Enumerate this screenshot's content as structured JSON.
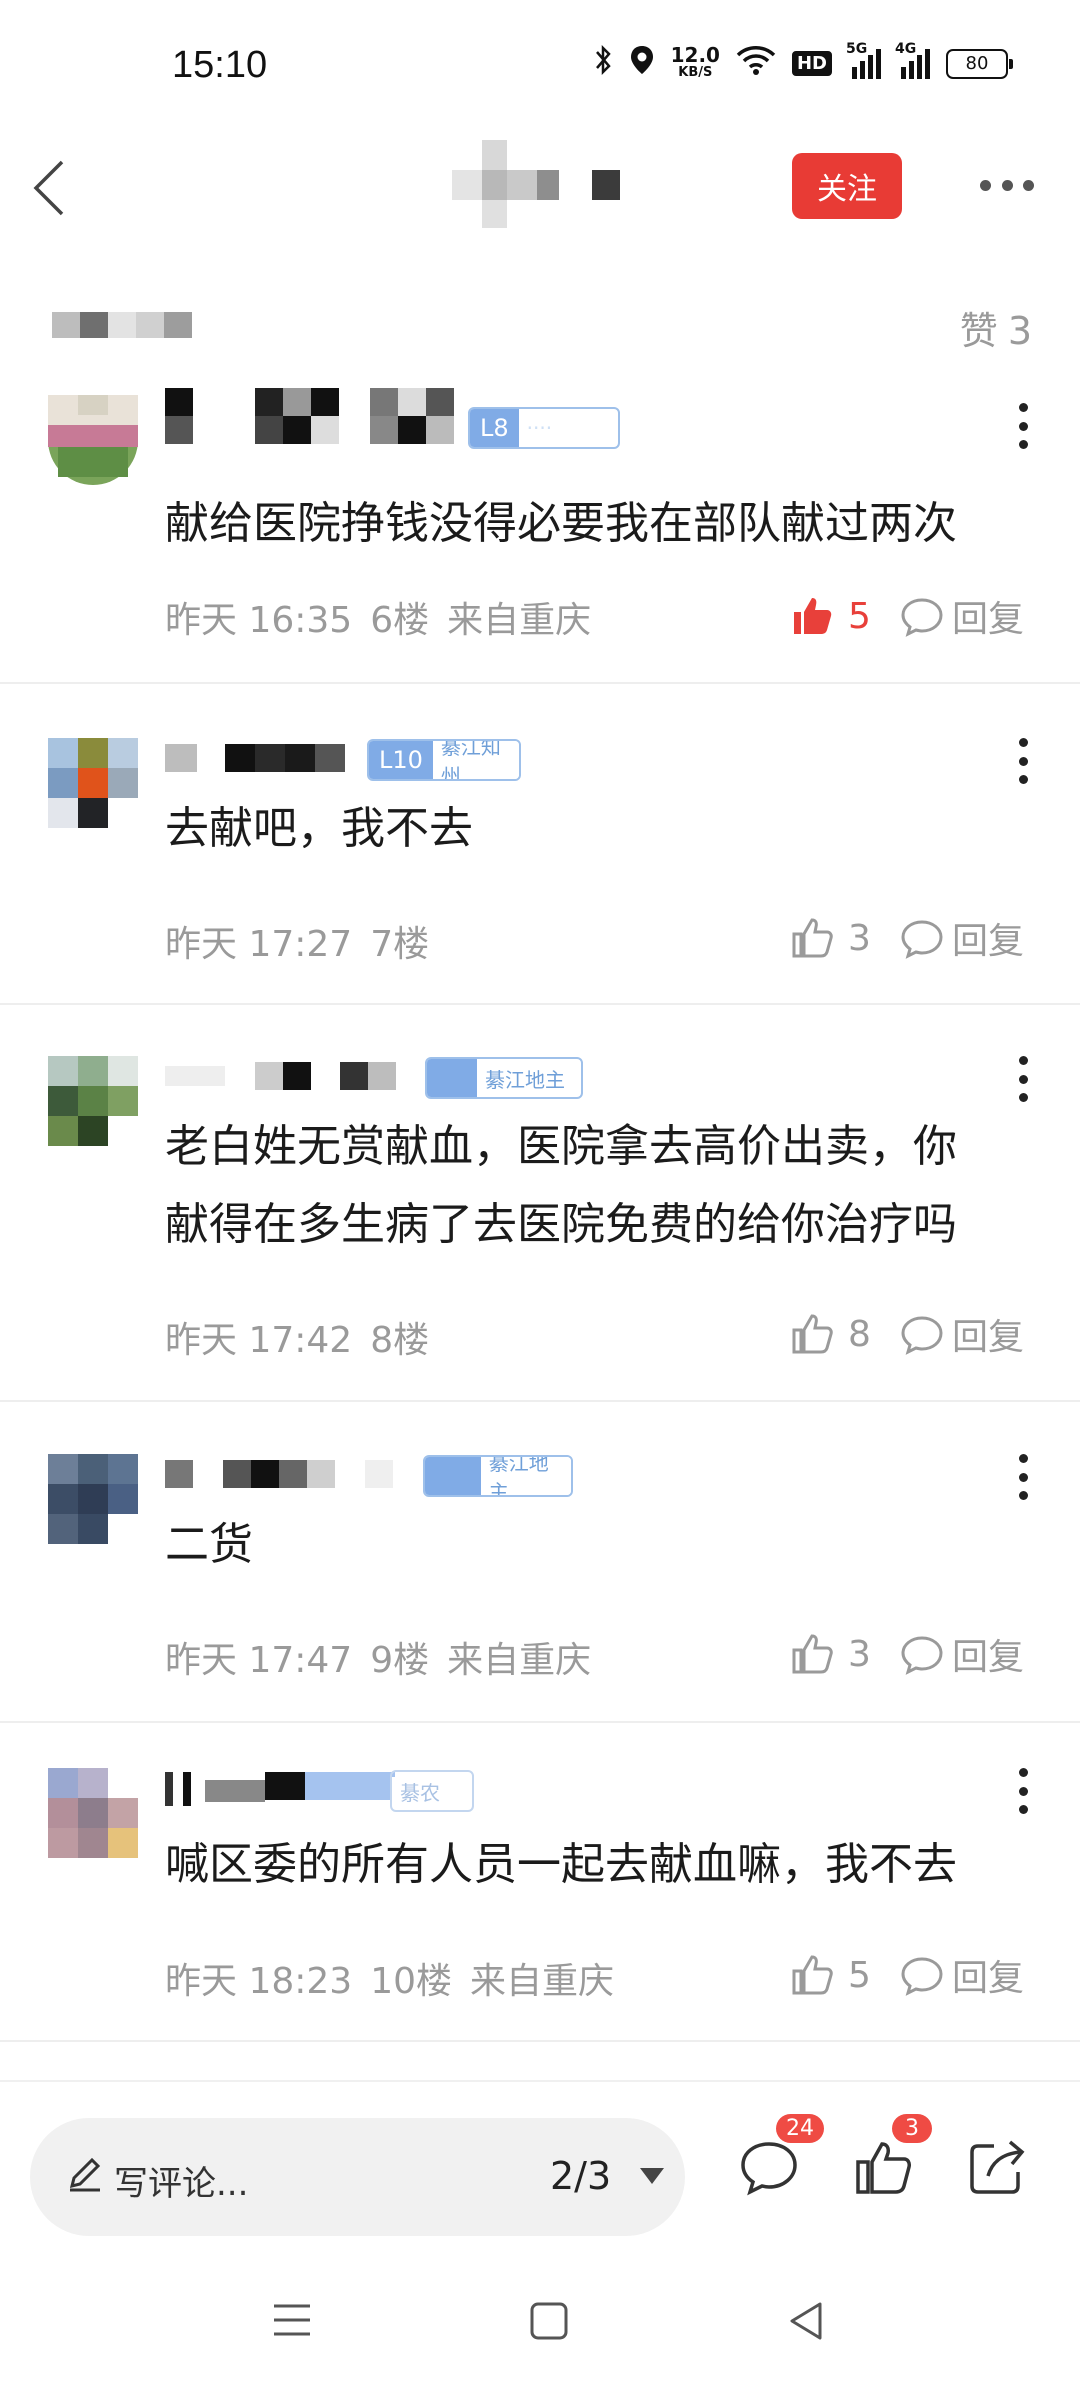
{
  "status_bar": {
    "time": "15:10",
    "net_speed_value": "12.0",
    "net_speed_unit": "KB/S",
    "hd_label": "HD",
    "signal1_label": "5G",
    "signal2_label": "4G",
    "battery": "80"
  },
  "header": {
    "follow_label": "关注",
    "likes_label": "赞",
    "likes_count": "3"
  },
  "comments": [
    {
      "level": "L8",
      "text_lines": [
        "献给医院挣钱没得必要我在部队献过两次"
      ],
      "time": "昨天 16:35",
      "floor": "6楼",
      "location": "来自重庆",
      "likes": "5",
      "liked": true,
      "reply_label": "回复"
    },
    {
      "level": "L10",
      "badge": "綦江知州",
      "text_lines": [
        "去献吧，我不去"
      ],
      "time": "昨天 17:27",
      "floor": "7楼",
      "location": "",
      "likes": "3",
      "liked": false,
      "reply_label": "回复"
    },
    {
      "level": "",
      "badge": "綦江地主",
      "text_lines": [
        "老白姓无赏献血，医院拿去高价出卖，你",
        "献得在多生病了去医院免费的给你治疗吗"
      ],
      "time": "昨天 17:42",
      "floor": "8楼",
      "location": "",
      "likes": "8",
      "liked": false,
      "reply_label": "回复"
    },
    {
      "level": "",
      "badge": "綦江地主",
      "text_lines": [
        "二货"
      ],
      "time": "昨天 17:47",
      "floor": "9楼",
      "location": "来自重庆",
      "likes": "3",
      "liked": false,
      "reply_label": "回复"
    },
    {
      "level": "",
      "badge": "綦农",
      "text_lines": [
        "喊区委的所有人员一起去献血嘛，我不去"
      ],
      "time": "昨天 18:23",
      "floor": "10楼",
      "location": "来自重庆",
      "likes": "5",
      "liked": false,
      "reply_label": "回复"
    }
  ],
  "bottom_bar": {
    "write_placeholder": "写评论...",
    "page_indicator": "2/3",
    "comment_badge": "24",
    "like_badge": "3"
  },
  "colors": {
    "accent_red": "#e83b35",
    "meta_gray": "#9a9a9a",
    "level_blue": "#80abe6"
  }
}
